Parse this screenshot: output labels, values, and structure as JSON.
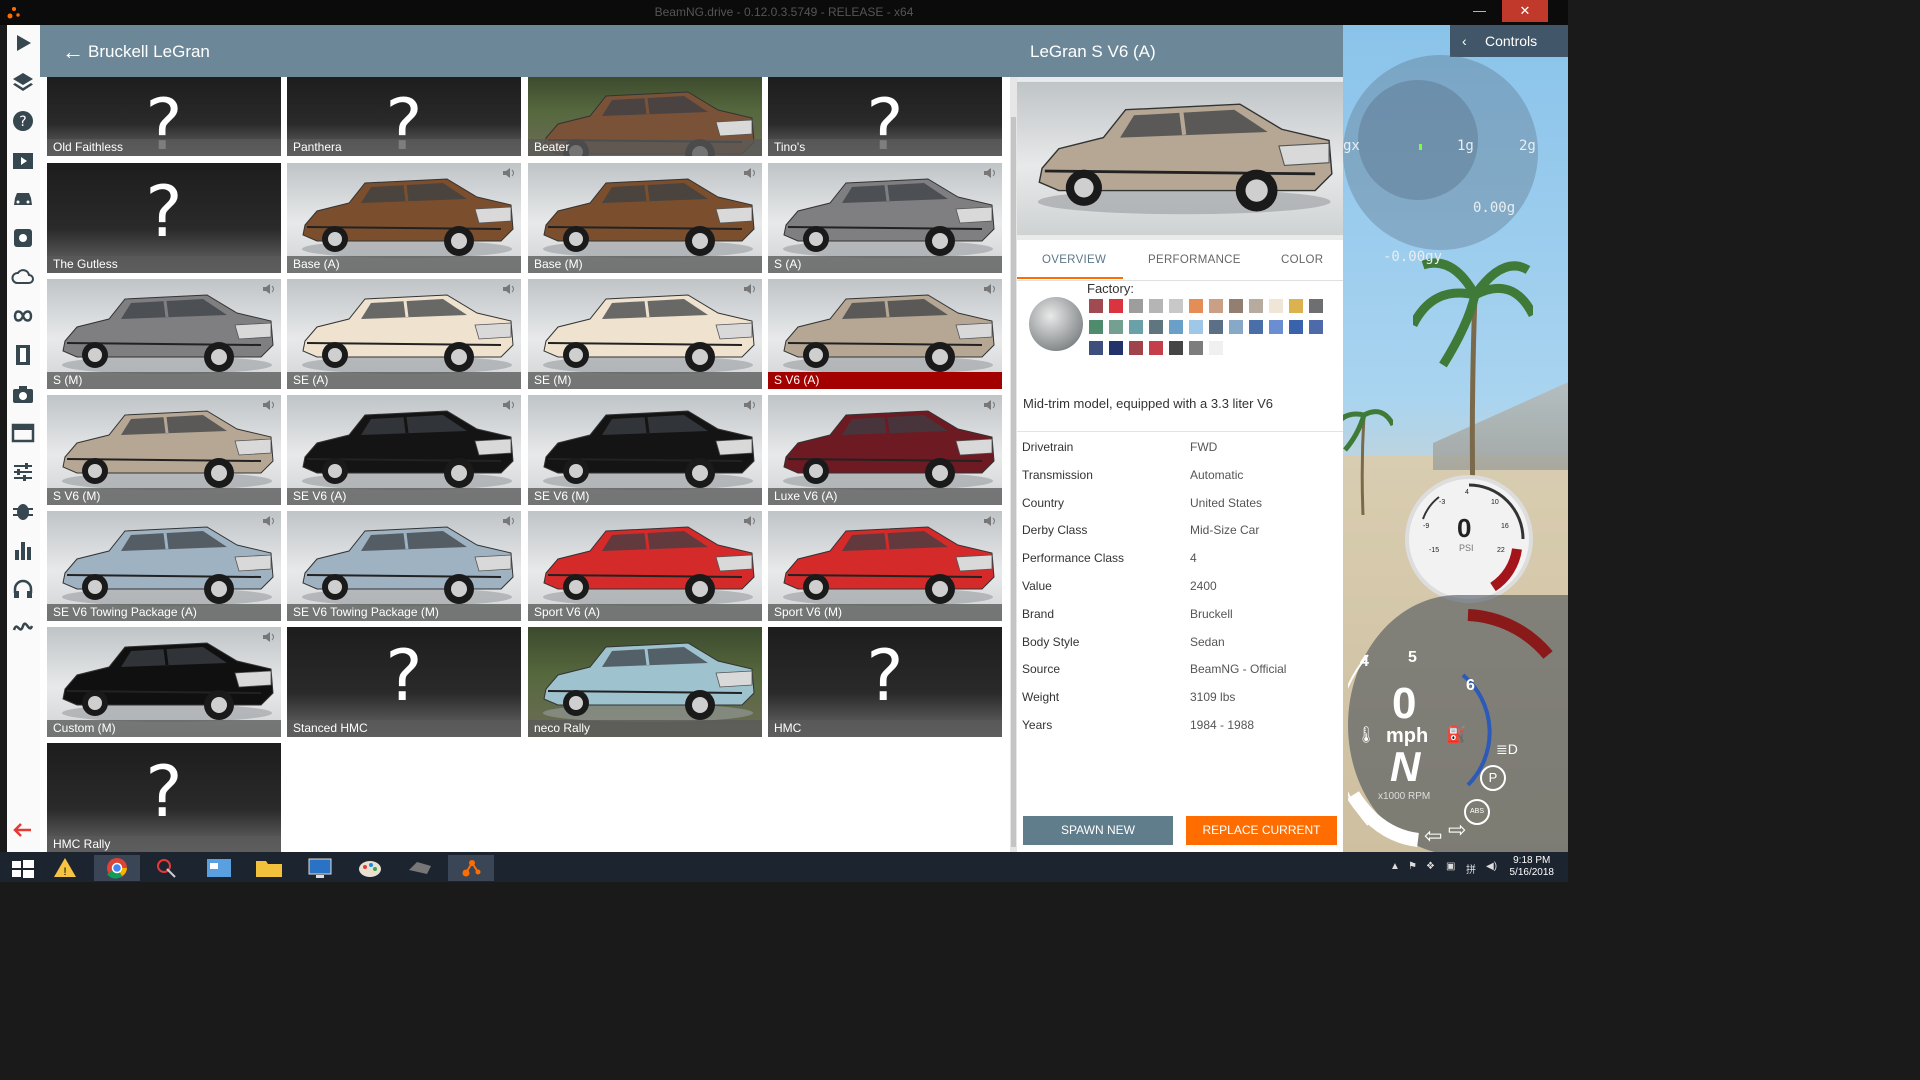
{
  "window": {
    "title": "BeamNG.drive - 0.12.0.3.5749 - RELEASE - x64",
    "minimize": "—",
    "close": "✕"
  },
  "header": {
    "back_icon": "arrow-left-icon",
    "title": "Bruckell LeGran"
  },
  "toolbar": [
    "play-icon",
    "layers-icon",
    "help-icon",
    "video-icon",
    "car-icon",
    "gear-icon",
    "cloud-icon",
    "loop-icon",
    "film-icon",
    "camera-icon",
    "window-icon",
    "sliders-icon",
    "bug-icon",
    "bar-chart-icon",
    "headphones-icon",
    "wave-icon",
    "exit-arrow-icon"
  ],
  "vehicles": [
    {
      "label": "Old Faithless",
      "kind": "unknown"
    },
    {
      "label": "Panthera",
      "kind": "unknown"
    },
    {
      "label": "Beater",
      "kind": "scene",
      "color": "#7a5238"
    },
    {
      "label": "Tino's",
      "kind": "unknown"
    },
    {
      "label": "The Gutless",
      "kind": "unknown"
    },
    {
      "label": "Base (A)",
      "kind": "car",
      "color": "#7b4f2d"
    },
    {
      "label": "Base (M)",
      "kind": "car",
      "color": "#7b4f2d"
    },
    {
      "label": "S (A)",
      "kind": "car",
      "color": "#7f7f82"
    },
    {
      "label": "S (M)",
      "kind": "car",
      "color": "#7f7f82"
    },
    {
      "label": "SE (A)",
      "kind": "car",
      "color": "#efe2cf"
    },
    {
      "label": "SE (M)",
      "kind": "car",
      "color": "#efe2cf"
    },
    {
      "label": "S V6 (A)",
      "kind": "car",
      "color": "#b6a795",
      "selected": true
    },
    {
      "label": "S V6 (M)",
      "kind": "car",
      "color": "#b6a795"
    },
    {
      "label": "SE V6 (A)",
      "kind": "car",
      "color": "#141414"
    },
    {
      "label": "SE V6 (M)",
      "kind": "car",
      "color": "#141414"
    },
    {
      "label": "Luxe V6 (A)",
      "kind": "car",
      "color": "#6e1a22"
    },
    {
      "label": "SE V6 Towing Package (A)",
      "kind": "car",
      "color": "#9fb2c1"
    },
    {
      "label": "SE V6 Towing Package (M)",
      "kind": "car",
      "color": "#9fb2c1"
    },
    {
      "label": "Sport V6 (A)",
      "kind": "car",
      "color": "#d52a2a"
    },
    {
      "label": "Sport V6 (M)",
      "kind": "car",
      "color": "#d52a2a"
    },
    {
      "label": "Custom (M)",
      "kind": "car",
      "color": "#101010"
    },
    {
      "label": "Stanced HMC",
      "kind": "unknown"
    },
    {
      "label": "neco Rally",
      "kind": "scene",
      "color": "#9ec3cf"
    },
    {
      "label": "HMC",
      "kind": "unknown"
    },
    {
      "label": "HMC Rally",
      "kind": "unknown"
    }
  ],
  "detail": {
    "title": "LeGran S V6 (A)",
    "car_color": "#b6a795",
    "tabs": [
      "OVERVIEW",
      "PERFORMANCE",
      "COLOR"
    ],
    "factory_label": "Factory:",
    "swatches": [
      "#a04a52",
      "#d9343f",
      "#9d9d9d",
      "#b5b5b5",
      "#c8c8c8",
      "#e48d57",
      "#c9a086",
      "#927f72",
      "#b7aba0",
      "#efe6d8",
      "#dcb24f",
      "#6d6f70",
      "#4f8b6d",
      "#73a090",
      "#6aa0a8",
      "#5f7680",
      "#6aa0c8",
      "#9fc7e8",
      "#5b6f86",
      "#88a8c8",
      "#4a6fa8",
      "#6b8ed2",
      "#3b63ad",
      "#4e6aa8",
      "#3e4f7e",
      "#22336b",
      "#a0434b",
      "#c53f4a",
      "#454545",
      "#7d7d7d",
      "#f0f0f0"
    ],
    "description": "Mid-trim model, equipped with a 3.3 liter V6",
    "properties": [
      {
        "k": "Drivetrain",
        "v": "FWD"
      },
      {
        "k": "Transmission",
        "v": "Automatic"
      },
      {
        "k": "Country",
        "v": "United States"
      },
      {
        "k": "Derby Class",
        "v": "Mid-Size Car"
      },
      {
        "k": "Performance Class",
        "v": "4"
      },
      {
        "k": "Value",
        "v": "2400"
      },
      {
        "k": "Brand",
        "v": "Bruckell"
      },
      {
        "k": "Body Style",
        "v": "Sedan"
      },
      {
        "k": "Source",
        "v": "BeamNG - Official"
      },
      {
        "k": "Weight",
        "v": "3109 lbs"
      },
      {
        "k": "Years",
        "v": "1984 - 1988"
      }
    ],
    "spawn_label": "SPAWN NEW",
    "replace_label": "REPLACE CURRENT"
  },
  "hud": {
    "controls_label": "Controls",
    "gforce_axis_x": "gx",
    "gforce_1g": "1g",
    "gforce_2g": "2g",
    "gforce_x_value": "0.00g",
    "gforce_y_value": "-0.00gy",
    "boost_value": "0",
    "boost_unit": "PSI",
    "speed_value": "0",
    "speed_unit": "mph",
    "gear": "N",
    "rpm_unit": "x1000 RPM",
    "rpm_ticks": [
      "4",
      "5",
      "6"
    ],
    "boost_ticks": [
      "-3",
      "4",
      "10",
      "-9",
      "16",
      "-15",
      "22"
    ]
  },
  "taskbar": {
    "time": "9:18 PM",
    "date": "5/16/2018"
  }
}
